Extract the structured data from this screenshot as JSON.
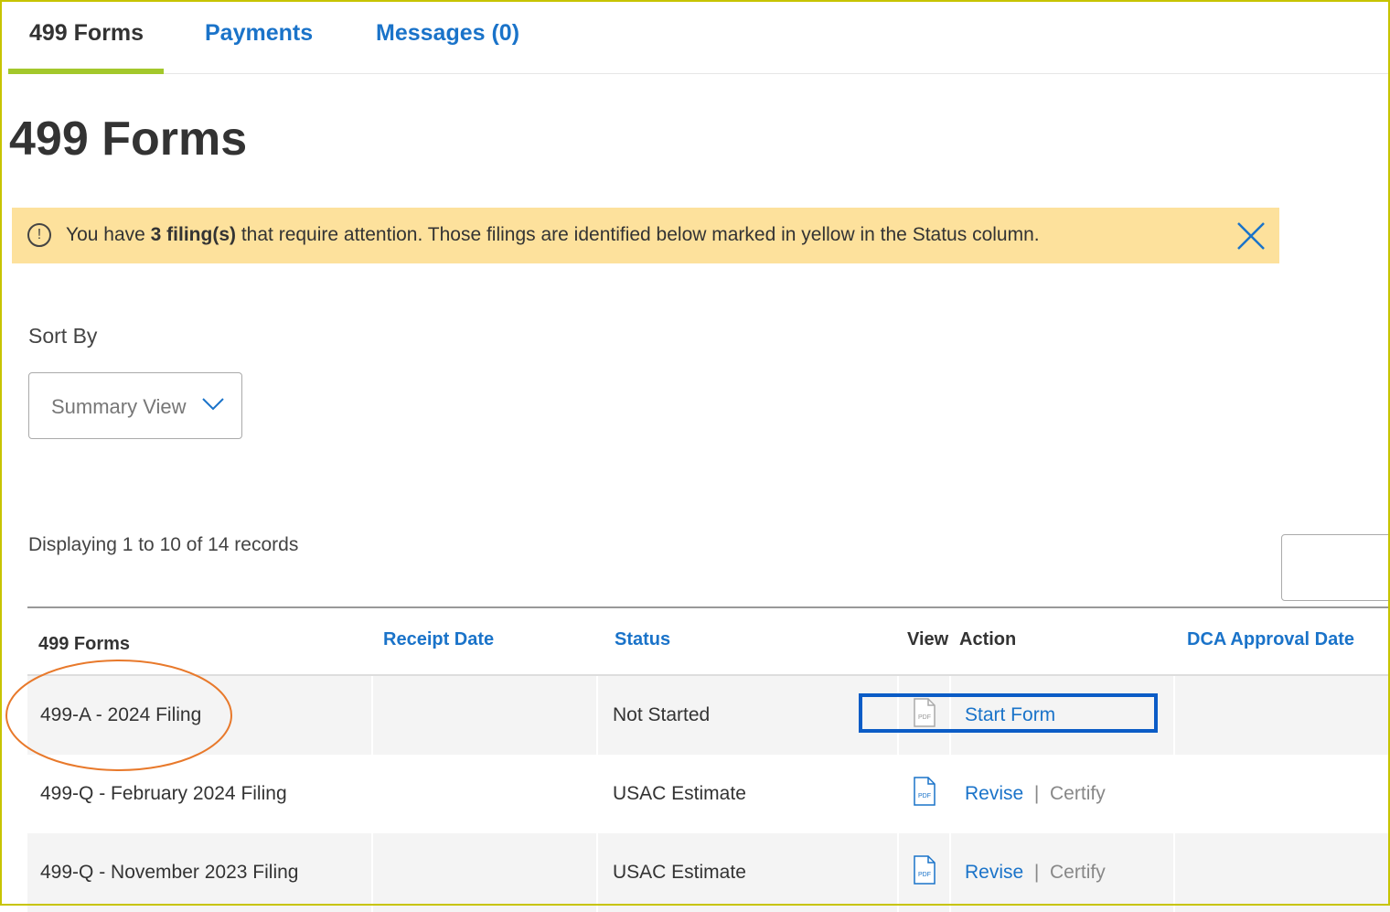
{
  "tabs": [
    {
      "label": "499 Forms",
      "active": true
    },
    {
      "label": "Payments",
      "active": false
    },
    {
      "label": "Messages (0)",
      "active": false
    }
  ],
  "page_title": "499 Forms",
  "alert": {
    "prefix": "You have ",
    "count_text": "3 filing(s)",
    "suffix": " that require attention. Those filings are identified below marked in yellow in the Status column.",
    "icon": "info-circle-icon",
    "close_icon": "close-icon"
  },
  "sort": {
    "label": "Sort By",
    "selected": "Summary View"
  },
  "records_text": "Displaying 1 to 10 of 14 records",
  "table": {
    "headers": {
      "forms": "499 Forms",
      "receipt_date": "Receipt Date",
      "status": "Status",
      "view": "View",
      "action": "Action",
      "dca_approval_date": "DCA Approval Date"
    },
    "rows": [
      {
        "form": "499-A - 2024 Filing",
        "receipt_date": "",
        "status": "Not Started",
        "actions": [
          "Start Form"
        ],
        "dca_approval_date": ""
      },
      {
        "form": "499-Q - February 2024 Filing",
        "receipt_date": "",
        "status": "USAC Estimate",
        "actions": [
          "Revise",
          "Certify"
        ],
        "dca_approval_date": ""
      },
      {
        "form": "499-Q - November 2023 Filing",
        "receipt_date": "",
        "status": "USAC Estimate",
        "actions": [
          "Revise",
          "Certify"
        ],
        "dca_approval_date": ""
      }
    ],
    "action_separator": "|"
  },
  "colors": {
    "accent_green": "#a3c82b",
    "link_blue": "#1a73c9",
    "alert_yellow": "#fde19c",
    "highlight_box": "#0b5cc6",
    "highlight_ellipse": "#e8792b"
  }
}
